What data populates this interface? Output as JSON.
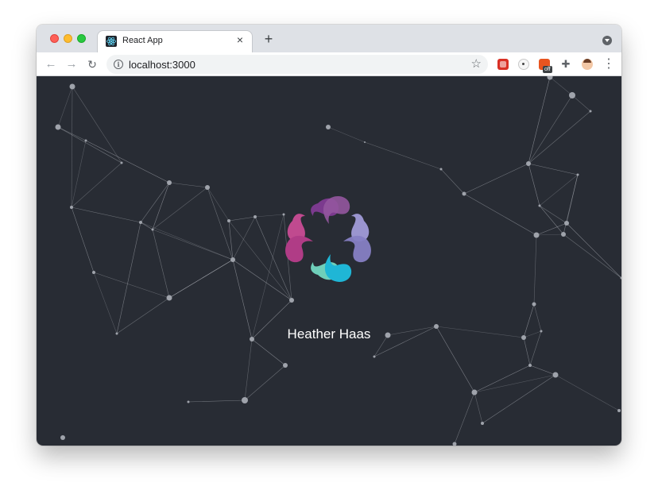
{
  "browser": {
    "tab": {
      "title": "React App",
      "close_glyph": "×",
      "favicon": "react-icon"
    },
    "new_tab_glyph": "+",
    "address": {
      "url": "localhost:3000",
      "info_glyph": "i",
      "star_glyph": "☆"
    },
    "nav": {
      "back": "←",
      "forward": "→",
      "reload": "↻"
    },
    "extension_badge": "off",
    "menu_glyph": "⋮"
  },
  "page": {
    "name": "Heather Haas",
    "background": "#282c34",
    "logo_colors": [
      "#7b3a8e",
      "#c04a8f",
      "#9a95cf",
      "#1fb6d6",
      "#6fcfba"
    ]
  }
}
